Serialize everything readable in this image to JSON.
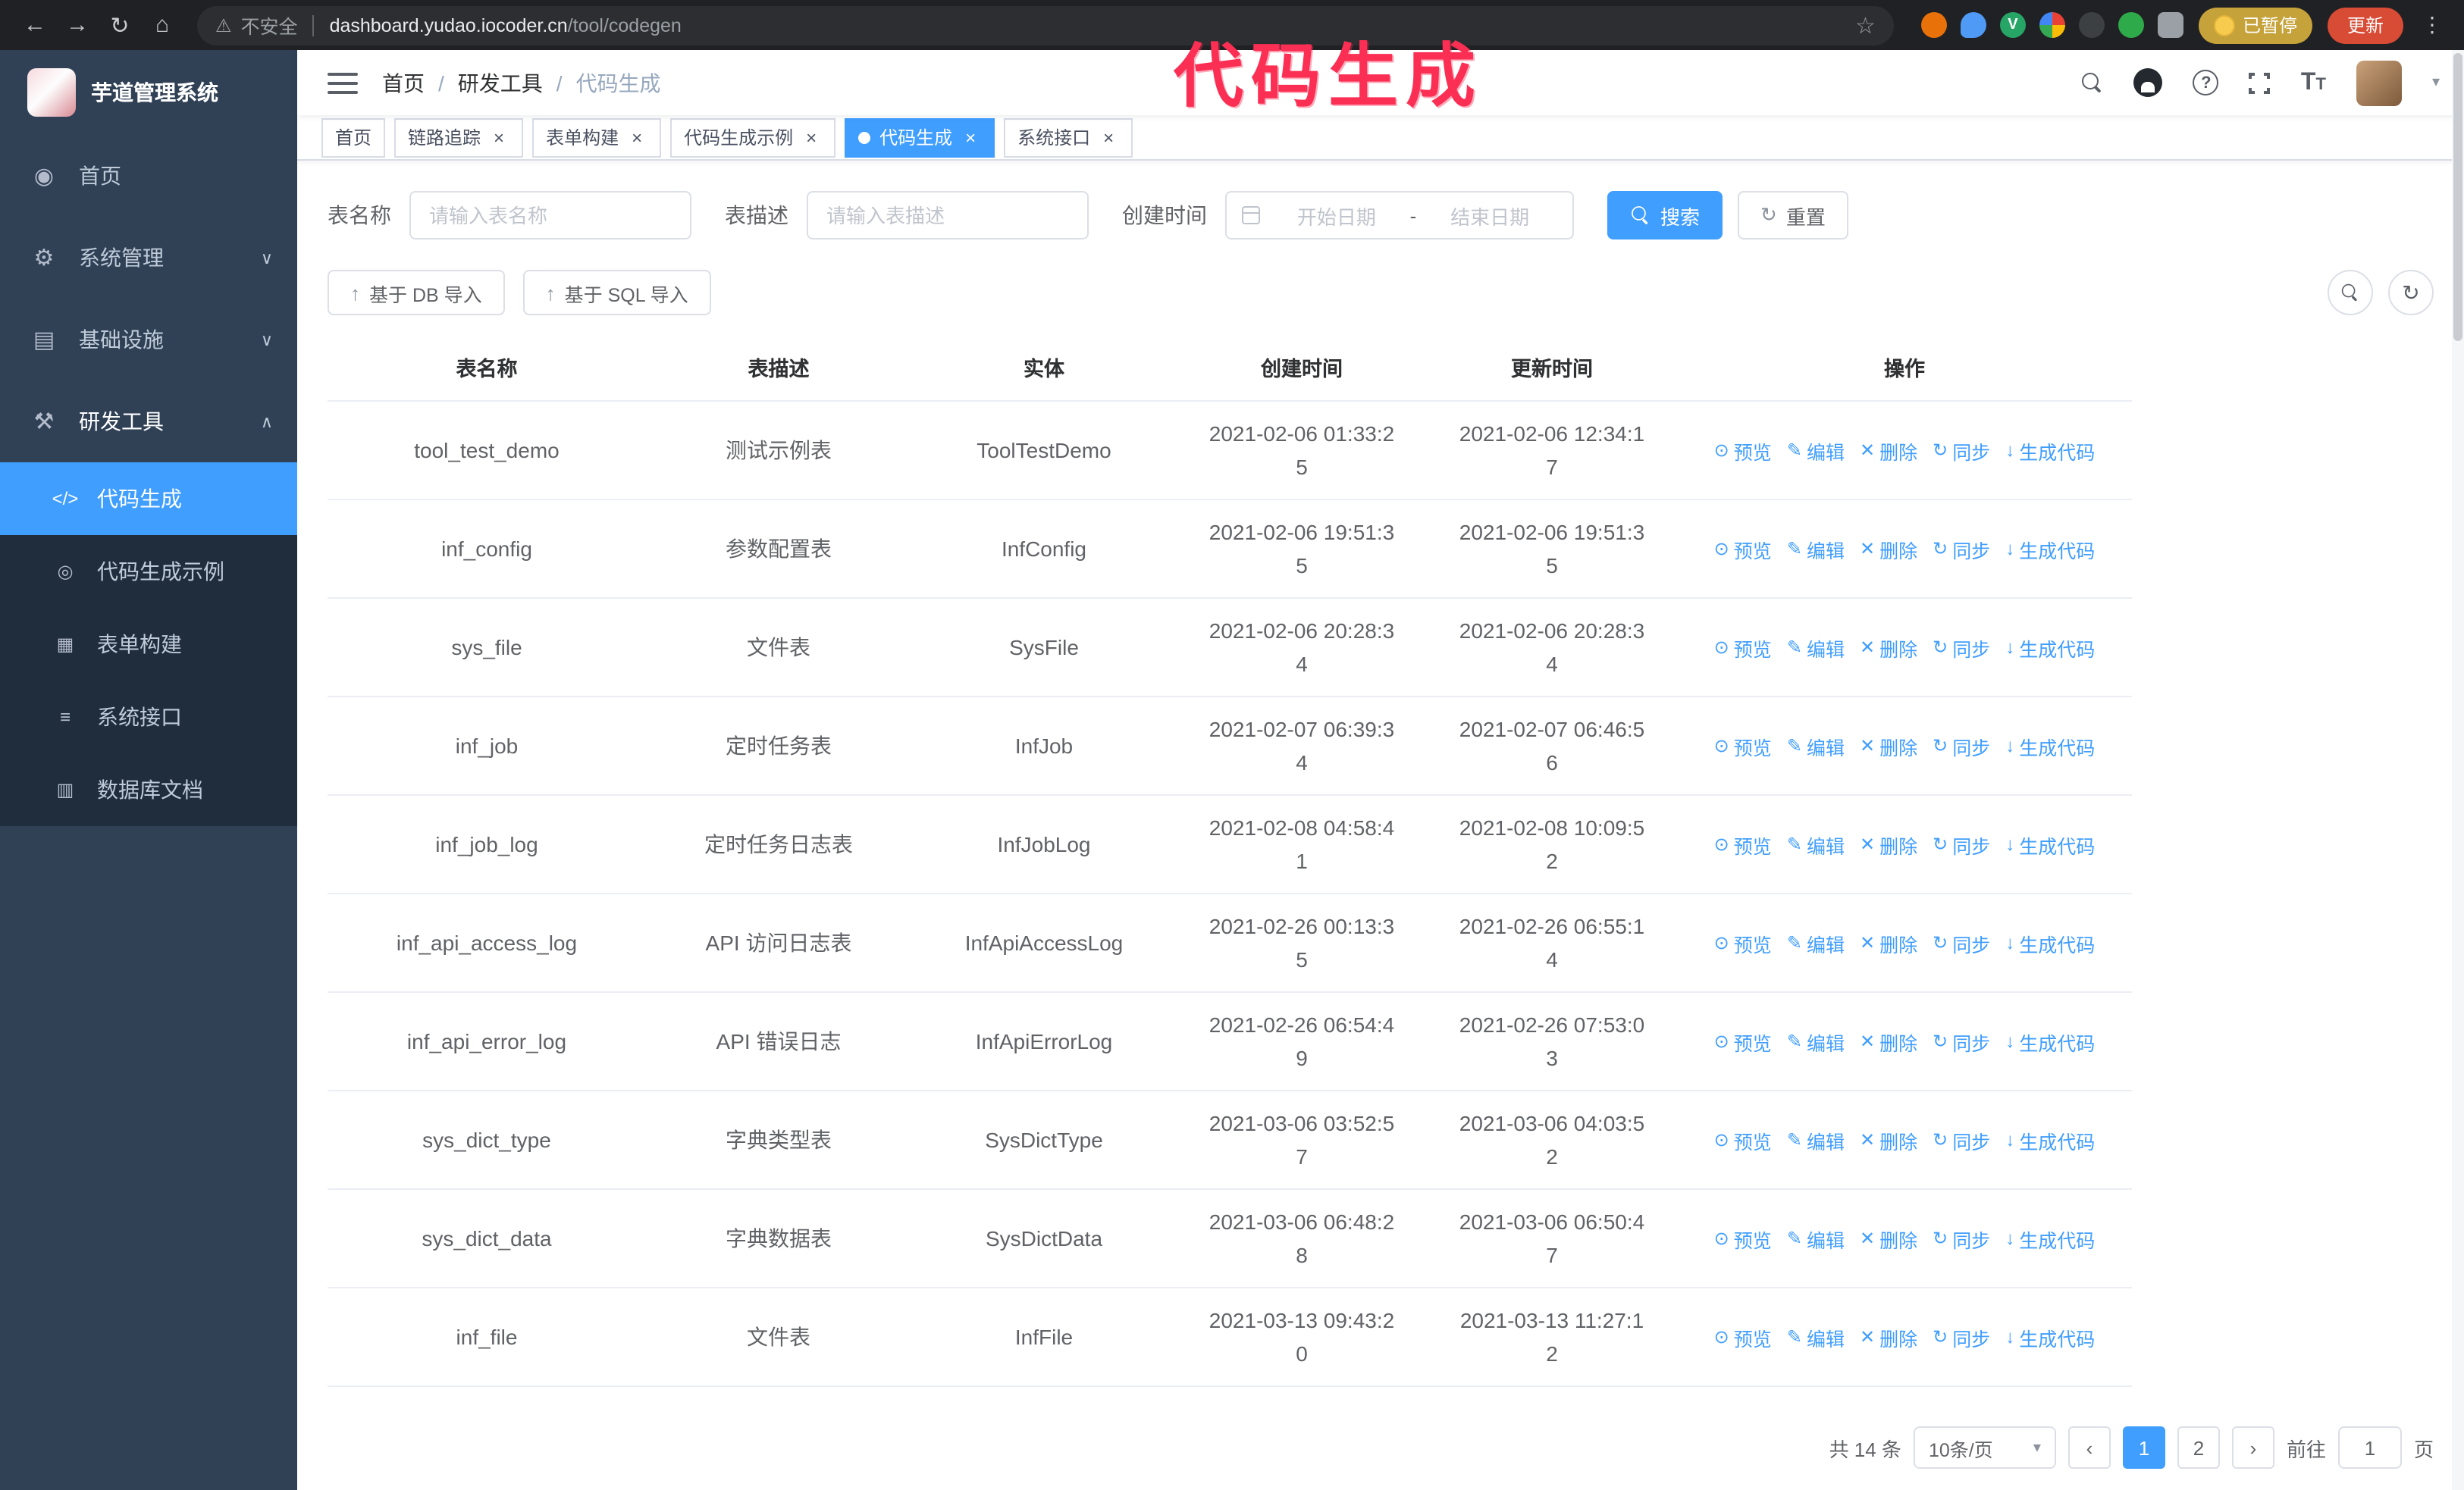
{
  "browser": {
    "security_label": "不安全",
    "url_host": "dashboard.yudao.iocoder.cn",
    "url_path": "/tool/codegen",
    "paused_badge": "已暂停",
    "update_button": "更新"
  },
  "annotation": {
    "text": "代码生成",
    "color": "#fb2e53"
  },
  "icons": {
    "back-icon": "←",
    "forward-icon": "→",
    "reload-icon": "↻",
    "home-icon": "⌂",
    "warning-icon": "⚠",
    "bookmark-star-icon": "☆",
    "kebab-menu-icon": "⋮",
    "dashboard-icon": "◉",
    "gear-icon": "⚙",
    "infra-icon": "▤",
    "tools-icon": "⚒",
    "code-icon": "</>",
    "example-icon": "◎",
    "form-icon": "▦",
    "api-icon": "≡",
    "database-icon": "▥",
    "chevron-down-icon": "∨",
    "chevron-up-icon": "∧",
    "caret-down-icon": "▾",
    "chevron-left-icon": "‹",
    "chevron-right-icon": "›",
    "upload-icon": "↑",
    "refresh-icon": "↻",
    "eye-icon": "⊙",
    "pencil-icon": "✎",
    "trash-icon": "✕",
    "sync-icon": "↻",
    "download-icon": "↓",
    "extension-v-icon": "V",
    "extension-leaf-icon": "✿"
  },
  "sidebar": {
    "logo_title": "芋道管理系统",
    "items": [
      {
        "label": "首页"
      },
      {
        "label": "系统管理"
      },
      {
        "label": "基础设施"
      },
      {
        "label": "研发工具"
      }
    ],
    "sub_items": [
      {
        "label": "代码生成"
      },
      {
        "label": "代码生成示例"
      },
      {
        "label": "表单构建"
      },
      {
        "label": "系统接口"
      },
      {
        "label": "数据库文档"
      }
    ]
  },
  "header": {
    "breadcrumb": [
      "首页",
      "研发工具",
      "代码生成"
    ]
  },
  "tabs": [
    {
      "label": "首页"
    },
    {
      "label": "链路追踪"
    },
    {
      "label": "表单构建"
    },
    {
      "label": "代码生成示例"
    },
    {
      "label": "代码生成"
    },
    {
      "label": "系统接口"
    }
  ],
  "filters": {
    "table_name_label": "表名称",
    "table_name_placeholder": "请输入表名称",
    "table_desc_label": "表描述",
    "table_desc_placeholder": "请输入表描述",
    "create_time_label": "创建时间",
    "date_start_placeholder": "开始日期",
    "date_separator": "-",
    "date_end_placeholder": "结束日期",
    "search_button": "搜索",
    "reset_button": "重置"
  },
  "toolbar": {
    "import_db_label": "基于 DB 导入",
    "import_sql_label": "基于 SQL 导入"
  },
  "table": {
    "columns": [
      "表名称",
      "表描述",
      "实体",
      "创建时间",
      "更新时间",
      "操作"
    ],
    "actions": [
      "预览",
      "编辑",
      "删除",
      "同步",
      "生成代码"
    ],
    "rows": [
      {
        "name": "tool_test_demo",
        "desc": "测试示例表",
        "entity": "ToolTestDemo",
        "created": "2021-02-06 01:33:25",
        "updated": "2021-02-06 12:34:17"
      },
      {
        "name": "inf_config",
        "desc": "参数配置表",
        "entity": "InfConfig",
        "created": "2021-02-06 19:51:35",
        "updated": "2021-02-06 19:51:35"
      },
      {
        "name": "sys_file",
        "desc": "文件表",
        "entity": "SysFile",
        "created": "2021-02-06 20:28:34",
        "updated": "2021-02-06 20:28:34"
      },
      {
        "name": "inf_job",
        "desc": "定时任务表",
        "entity": "InfJob",
        "created": "2021-02-07 06:39:34",
        "updated": "2021-02-07 06:46:56"
      },
      {
        "name": "inf_job_log",
        "desc": "定时任务日志表",
        "entity": "InfJobLog",
        "created": "2021-02-08 04:58:41",
        "updated": "2021-02-08 10:09:52"
      },
      {
        "name": "inf_api_access_log",
        "desc": "API 访问日志表",
        "entity": "InfApiAccessLog",
        "created": "2021-02-26 00:13:35",
        "updated": "2021-02-26 06:55:14"
      },
      {
        "name": "inf_api_error_log",
        "desc": "API 错误日志",
        "entity": "InfApiErrorLog",
        "created": "2021-02-26 06:54:49",
        "updated": "2021-02-26 07:53:03"
      },
      {
        "name": "sys_dict_type",
        "desc": "字典类型表",
        "entity": "SysDictType",
        "created": "2021-03-06 03:52:57",
        "updated": "2021-03-06 04:03:52"
      },
      {
        "name": "sys_dict_data",
        "desc": "字典数据表",
        "entity": "SysDictData",
        "created": "2021-03-06 06:48:28",
        "updated": "2021-03-06 06:50:47"
      },
      {
        "name": "inf_file",
        "desc": "文件表",
        "entity": "InfFile",
        "created": "2021-03-13 09:43:20",
        "updated": "2021-03-13 11:27:12"
      }
    ]
  },
  "pagination": {
    "total": "共 14 条",
    "page_size": "10条/页",
    "pages": [
      "1",
      "2"
    ],
    "goto_label": "前往",
    "goto_value": "1",
    "page_unit": "页"
  }
}
